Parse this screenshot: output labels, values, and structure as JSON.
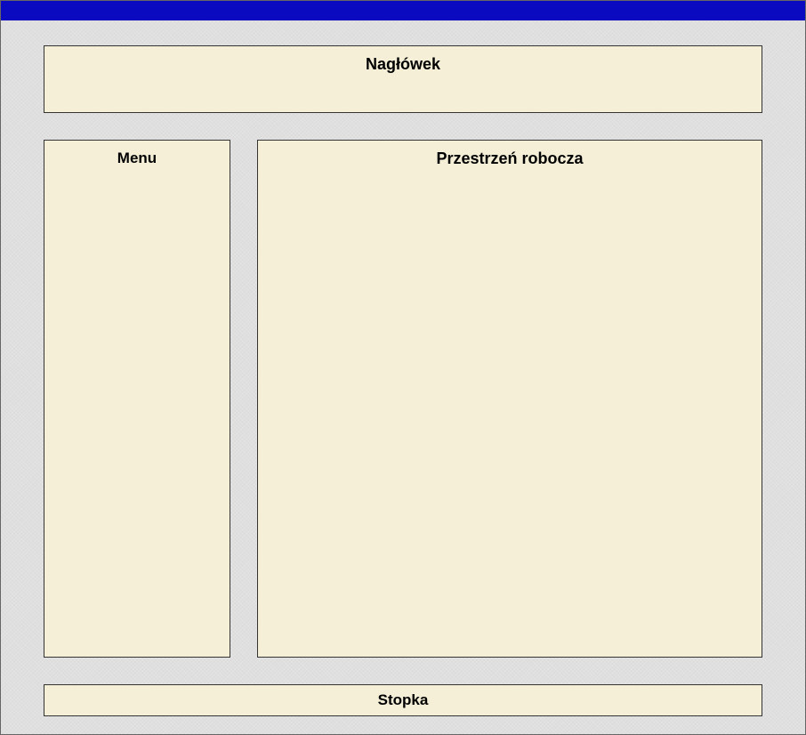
{
  "layout": {
    "header": {
      "title": "Nagłówek"
    },
    "menu": {
      "title": "Menu"
    },
    "workspace": {
      "title": "Przestrzeń robocza"
    },
    "footer": {
      "title": "Stopka"
    }
  },
  "colors": {
    "topbar": "#0a0ac0",
    "panel_background": "#f5efd8",
    "content_background": "#dcdcdc",
    "border": "#333333"
  }
}
